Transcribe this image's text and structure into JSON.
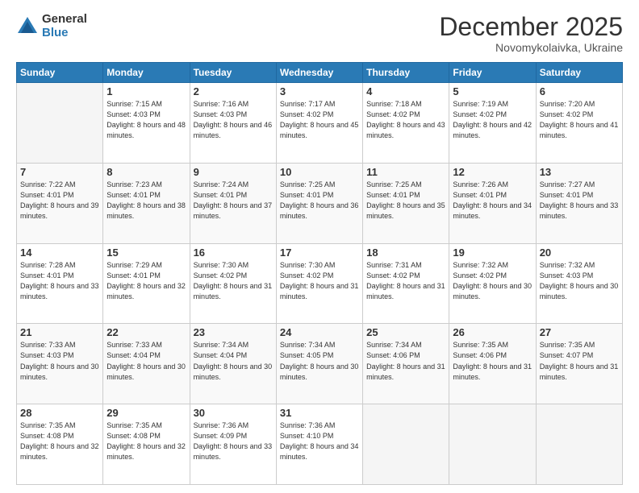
{
  "logo": {
    "general": "General",
    "blue": "Blue"
  },
  "header": {
    "month": "December 2025",
    "location": "Novomykolaivka, Ukraine"
  },
  "weekdays": [
    "Sunday",
    "Monday",
    "Tuesday",
    "Wednesday",
    "Thursday",
    "Friday",
    "Saturday"
  ],
  "weeks": [
    [
      {
        "day": "",
        "info": ""
      },
      {
        "day": "1",
        "info": "Sunrise: 7:15 AM\nSunset: 4:03 PM\nDaylight: 8 hours\nand 48 minutes."
      },
      {
        "day": "2",
        "info": "Sunrise: 7:16 AM\nSunset: 4:03 PM\nDaylight: 8 hours\nand 46 minutes."
      },
      {
        "day": "3",
        "info": "Sunrise: 7:17 AM\nSunset: 4:02 PM\nDaylight: 8 hours\nand 45 minutes."
      },
      {
        "day": "4",
        "info": "Sunrise: 7:18 AM\nSunset: 4:02 PM\nDaylight: 8 hours\nand 43 minutes."
      },
      {
        "day": "5",
        "info": "Sunrise: 7:19 AM\nSunset: 4:02 PM\nDaylight: 8 hours\nand 42 minutes."
      },
      {
        "day": "6",
        "info": "Sunrise: 7:20 AM\nSunset: 4:02 PM\nDaylight: 8 hours\nand 41 minutes."
      }
    ],
    [
      {
        "day": "7",
        "info": "Sunrise: 7:22 AM\nSunset: 4:01 PM\nDaylight: 8 hours\nand 39 minutes."
      },
      {
        "day": "8",
        "info": "Sunrise: 7:23 AM\nSunset: 4:01 PM\nDaylight: 8 hours\nand 38 minutes."
      },
      {
        "day": "9",
        "info": "Sunrise: 7:24 AM\nSunset: 4:01 PM\nDaylight: 8 hours\nand 37 minutes."
      },
      {
        "day": "10",
        "info": "Sunrise: 7:25 AM\nSunset: 4:01 PM\nDaylight: 8 hours\nand 36 minutes."
      },
      {
        "day": "11",
        "info": "Sunrise: 7:25 AM\nSunset: 4:01 PM\nDaylight: 8 hours\nand 35 minutes."
      },
      {
        "day": "12",
        "info": "Sunrise: 7:26 AM\nSunset: 4:01 PM\nDaylight: 8 hours\nand 34 minutes."
      },
      {
        "day": "13",
        "info": "Sunrise: 7:27 AM\nSunset: 4:01 PM\nDaylight: 8 hours\nand 33 minutes."
      }
    ],
    [
      {
        "day": "14",
        "info": "Sunrise: 7:28 AM\nSunset: 4:01 PM\nDaylight: 8 hours\nand 33 minutes."
      },
      {
        "day": "15",
        "info": "Sunrise: 7:29 AM\nSunset: 4:01 PM\nDaylight: 8 hours\nand 32 minutes."
      },
      {
        "day": "16",
        "info": "Sunrise: 7:30 AM\nSunset: 4:02 PM\nDaylight: 8 hours\nand 31 minutes."
      },
      {
        "day": "17",
        "info": "Sunrise: 7:30 AM\nSunset: 4:02 PM\nDaylight: 8 hours\nand 31 minutes."
      },
      {
        "day": "18",
        "info": "Sunrise: 7:31 AM\nSunset: 4:02 PM\nDaylight: 8 hours\nand 31 minutes."
      },
      {
        "day": "19",
        "info": "Sunrise: 7:32 AM\nSunset: 4:02 PM\nDaylight: 8 hours\nand 30 minutes."
      },
      {
        "day": "20",
        "info": "Sunrise: 7:32 AM\nSunset: 4:03 PM\nDaylight: 8 hours\nand 30 minutes."
      }
    ],
    [
      {
        "day": "21",
        "info": "Sunrise: 7:33 AM\nSunset: 4:03 PM\nDaylight: 8 hours\nand 30 minutes."
      },
      {
        "day": "22",
        "info": "Sunrise: 7:33 AM\nSunset: 4:04 PM\nDaylight: 8 hours\nand 30 minutes."
      },
      {
        "day": "23",
        "info": "Sunrise: 7:34 AM\nSunset: 4:04 PM\nDaylight: 8 hours\nand 30 minutes."
      },
      {
        "day": "24",
        "info": "Sunrise: 7:34 AM\nSunset: 4:05 PM\nDaylight: 8 hours\nand 30 minutes."
      },
      {
        "day": "25",
        "info": "Sunrise: 7:34 AM\nSunset: 4:06 PM\nDaylight: 8 hours\nand 31 minutes."
      },
      {
        "day": "26",
        "info": "Sunrise: 7:35 AM\nSunset: 4:06 PM\nDaylight: 8 hours\nand 31 minutes."
      },
      {
        "day": "27",
        "info": "Sunrise: 7:35 AM\nSunset: 4:07 PM\nDaylight: 8 hours\nand 31 minutes."
      }
    ],
    [
      {
        "day": "28",
        "info": "Sunrise: 7:35 AM\nSunset: 4:08 PM\nDaylight: 8 hours\nand 32 minutes."
      },
      {
        "day": "29",
        "info": "Sunrise: 7:35 AM\nSunset: 4:08 PM\nDaylight: 8 hours\nand 32 minutes."
      },
      {
        "day": "30",
        "info": "Sunrise: 7:36 AM\nSunset: 4:09 PM\nDaylight: 8 hours\nand 33 minutes."
      },
      {
        "day": "31",
        "info": "Sunrise: 7:36 AM\nSunset: 4:10 PM\nDaylight: 8 hours\nand 34 minutes."
      },
      {
        "day": "",
        "info": ""
      },
      {
        "day": "",
        "info": ""
      },
      {
        "day": "",
        "info": ""
      }
    ]
  ]
}
